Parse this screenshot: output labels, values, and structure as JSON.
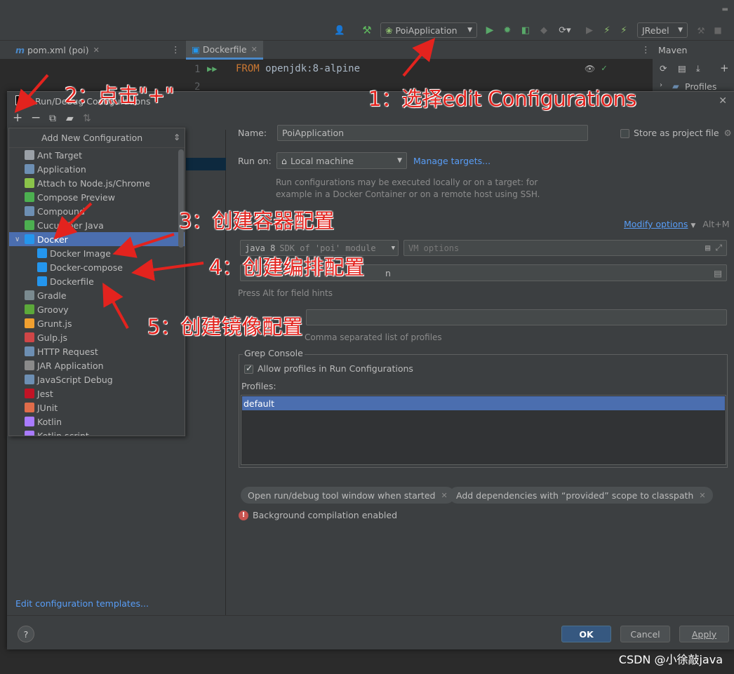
{
  "ide": {
    "run_config_select": "PoiApplication",
    "jrebel_select": "JRebel",
    "tabs": [
      {
        "icon": "m",
        "label": "pom.xml (poi)"
      },
      {
        "label": "Dockerfile"
      }
    ],
    "editor_lines": [
      {
        "num": "1",
        "keyword": "FROM",
        "text": " openjdk:8-alpine"
      },
      {
        "num": "2"
      }
    ],
    "maven_panel": {
      "title": "Maven",
      "tree_item": "Profiles"
    }
  },
  "dialog": {
    "title": "Run/Debug Configurations",
    "edit_templates_link": "Edit configuration templates...",
    "popup": {
      "header": "Add New Configuration",
      "items": [
        {
          "label": "Ant Target",
          "icon": "ant-icon",
          "color": "#9aa0a6"
        },
        {
          "label": "Application",
          "icon": "application-icon",
          "color": "#6d8fb3"
        },
        {
          "label": "Attach to Node.js/Chrome",
          "icon": "nodejs-icon",
          "color": "#8bc34a"
        },
        {
          "label": "Compose Preview",
          "icon": "compose-icon",
          "color": "#4caf50"
        },
        {
          "label": "Compound",
          "icon": "compound-icon",
          "color": "#6d8fb3"
        },
        {
          "label": "Cucumber Java",
          "icon": "cucumber-icon",
          "color": "#4caf50"
        },
        {
          "label": "Docker",
          "icon": "docker-icon",
          "color": "#2496ed",
          "expanded": true,
          "selected": true
        },
        {
          "label": "Docker Image",
          "icon": "docker-icon",
          "color": "#2496ed",
          "child": true
        },
        {
          "label": "Docker-compose",
          "icon": "docker-icon",
          "color": "#2496ed",
          "child": true
        },
        {
          "label": "Dockerfile",
          "icon": "docker-icon",
          "color": "#2496ed",
          "child": true
        },
        {
          "label": "Gradle",
          "icon": "gradle-icon",
          "color": "#7a8a8f"
        },
        {
          "label": "Groovy",
          "icon": "groovy-icon",
          "color": "#5ca83a"
        },
        {
          "label": "Grunt.js",
          "icon": "grunt-icon",
          "color": "#f0a030"
        },
        {
          "label": "Gulp.js",
          "icon": "gulp-icon",
          "color": "#cf4647"
        },
        {
          "label": "HTTP Request",
          "icon": "http-icon",
          "color": "#6d8fb3"
        },
        {
          "label": "JAR Application",
          "icon": "jar-icon",
          "color": "#8a8a8a"
        },
        {
          "label": "JavaScript Debug",
          "icon": "js-debug-icon",
          "color": "#6d8fb3"
        },
        {
          "label": "Jest",
          "icon": "jest-icon",
          "color": "#c21325"
        },
        {
          "label": "JUnit",
          "icon": "junit-icon",
          "color": "#e06c4a"
        },
        {
          "label": "Kotlin",
          "icon": "kotlin-icon",
          "color": "#a97bff"
        },
        {
          "label": "Kotlin script",
          "icon": "kotlin-script-icon",
          "color": "#a97bff"
        }
      ]
    },
    "form": {
      "name_label": "Name:",
      "name_value": "PoiApplication",
      "store_label": "Store as project file",
      "run_on_label": "Run on:",
      "run_on_value": "Local machine",
      "manage_targets": "Manage targets...",
      "run_on_hint_1": "Run configurations may be executed locally or on a target: for",
      "run_on_hint_2": "example in a Docker Container or on a remote host using SSH.",
      "modify_options": "Modify options",
      "modify_shortcut": "Alt+M",
      "sdk_value": "java 8",
      "sdk_hint": "SDK of 'poi' module",
      "vm_placeholder": "VM options",
      "main_class_suffix": "n",
      "field_hints": "Press Alt for field hints",
      "profiles_hint": "Comma separated list of profiles",
      "grep_title": "Grep Console",
      "allow_profiles": "Allow profiles in Run Configurations",
      "profiles_label": "Profiles:",
      "profiles": [
        "default"
      ],
      "chips": [
        "Open run/debug tool window when started",
        "Add dependencies with “provided” scope to classpath"
      ],
      "warning": "Background compilation enabled"
    },
    "buttons": {
      "help": "?",
      "ok": "OK",
      "cancel": "Cancel",
      "apply": "Apply"
    }
  },
  "annotations": {
    "a1": "1：选择edit Configurations",
    "a2": "2：点击\"+\"",
    "a3": "3：创建容器配置",
    "a4": "4：创建编排配置",
    "a5": "5：创建镜像配置"
  },
  "watermark": "CSDN @小徐敲java",
  "colors": {
    "accent": "#4b6eaf",
    "link": "#589df6",
    "annotation": "#e3231e"
  }
}
